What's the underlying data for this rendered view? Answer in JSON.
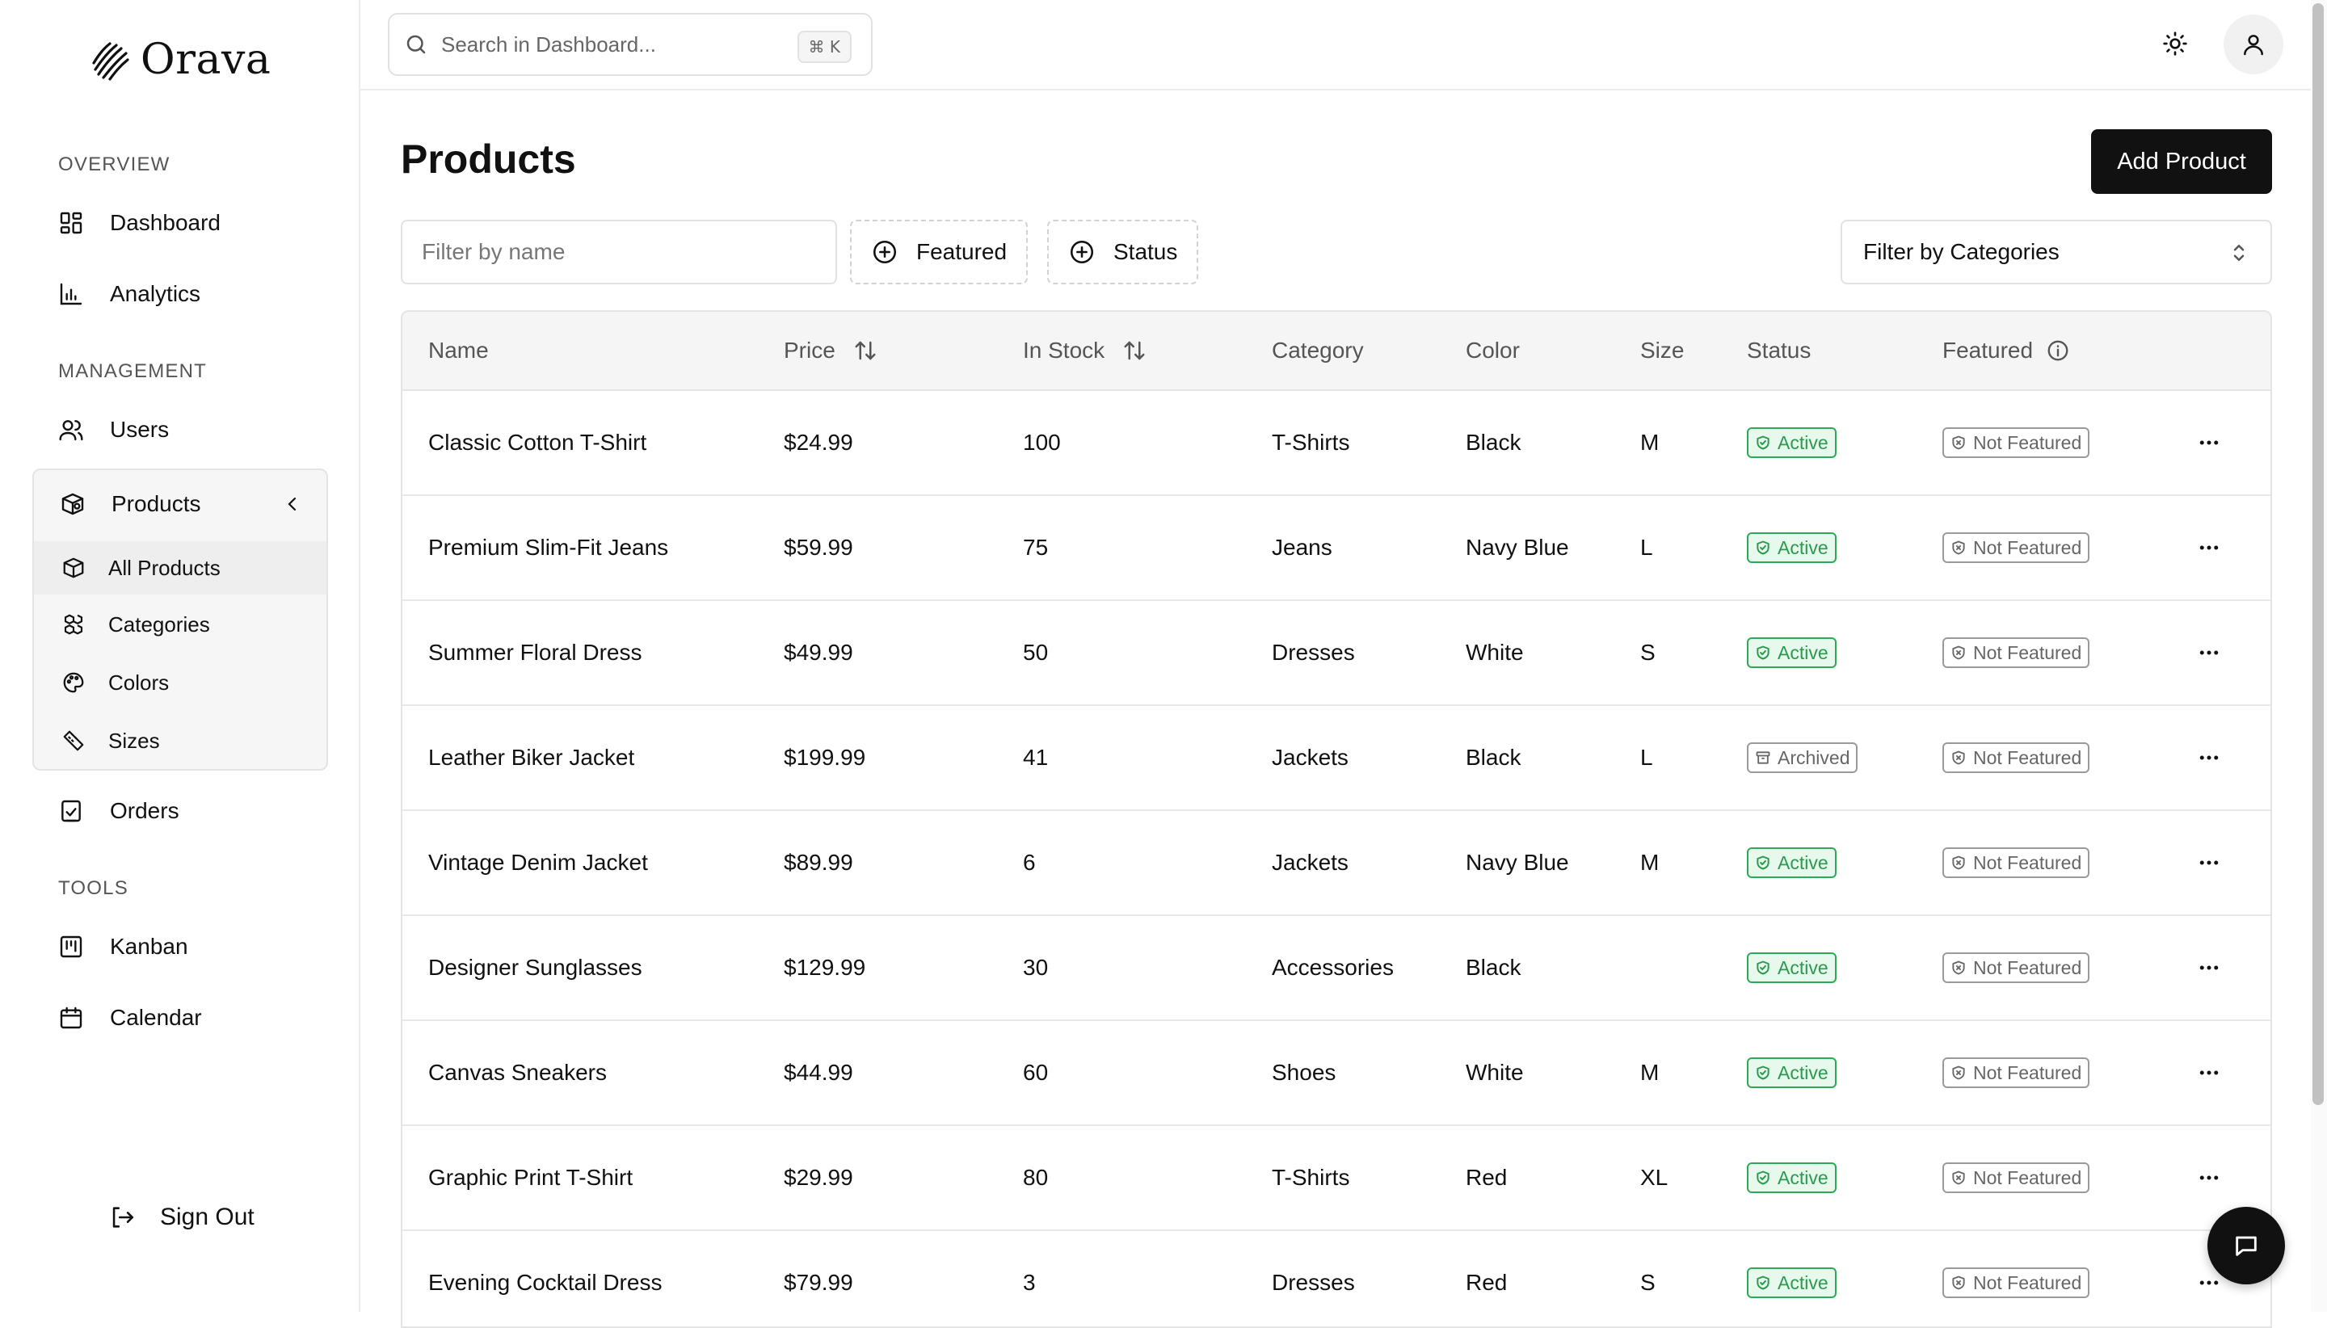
{
  "brand": {
    "name": "Orava"
  },
  "sidebar": {
    "sections": {
      "overview": "OVERVIEW",
      "management": "MANAGEMENT",
      "tools": "TOOLS"
    },
    "items": {
      "dashboard": {
        "label": "Dashboard",
        "icon": "dashboard-grid-icon"
      },
      "analytics": {
        "label": "Analytics",
        "icon": "bar-chart-icon"
      },
      "users": {
        "label": "Users",
        "icon": "users-icon"
      },
      "products": {
        "label": "Products",
        "icon": "products-icon"
      },
      "orders": {
        "label": "Orders",
        "icon": "clipboard-check-icon"
      },
      "kanban": {
        "label": "Kanban",
        "icon": "kanban-icon"
      },
      "calendar": {
        "label": "Calendar",
        "icon": "calendar-icon"
      }
    },
    "products_sub": {
      "all_products": "All Products",
      "categories": "Categories",
      "colors": "Colors",
      "sizes": "Sizes"
    },
    "sign_out": "Sign Out"
  },
  "topbar": {
    "search_placeholder": "Search in Dashboard...",
    "shortcut": "⌘ K"
  },
  "main": {
    "title": "Products",
    "add_button": "Add Product",
    "filter_placeholder": "Filter by name",
    "featured_filter": "Featured",
    "status_filter": "Status",
    "category_select": "Filter by Categories"
  },
  "table": {
    "columns": {
      "name": "Name",
      "price": "Price",
      "stock": "In Stock",
      "category": "Category",
      "color": "Color",
      "size": "Size",
      "status": "Status",
      "featured": "Featured"
    },
    "rows": [
      {
        "name": "Classic Cotton T-Shirt",
        "price": "$24.99",
        "stock": "100",
        "category": "T-Shirts",
        "color": "Black",
        "size": "M",
        "status": "Active",
        "featured": "Not Featured"
      },
      {
        "name": "Premium Slim-Fit Jeans",
        "price": "$59.99",
        "stock": "75",
        "category": "Jeans",
        "color": "Navy Blue",
        "size": "L",
        "status": "Active",
        "featured": "Not Featured"
      },
      {
        "name": "Summer Floral Dress",
        "price": "$49.99",
        "stock": "50",
        "category": "Dresses",
        "color": "White",
        "size": "S",
        "status": "Active",
        "featured": "Not Featured"
      },
      {
        "name": "Leather Biker Jacket",
        "price": "$199.99",
        "stock": "41",
        "category": "Jackets",
        "color": "Black",
        "size": "L",
        "status": "Archived",
        "featured": "Not Featured"
      },
      {
        "name": "Vintage Denim Jacket",
        "price": "$89.99",
        "stock": "6",
        "category": "Jackets",
        "color": "Navy Blue",
        "size": "M",
        "status": "Active",
        "featured": "Not Featured"
      },
      {
        "name": "Designer Sunglasses",
        "price": "$129.99",
        "stock": "30",
        "category": "Accessories",
        "color": "Black",
        "size": "",
        "status": "Active",
        "featured": "Not Featured"
      },
      {
        "name": "Canvas Sneakers",
        "price": "$44.99",
        "stock": "60",
        "category": "Shoes",
        "color": "White",
        "size": "M",
        "status": "Active",
        "featured": "Not Featured"
      },
      {
        "name": "Graphic Print T-Shirt",
        "price": "$29.99",
        "stock": "80",
        "category": "T-Shirts",
        "color": "Red",
        "size": "XL",
        "status": "Active",
        "featured": "Not Featured"
      },
      {
        "name": "Evening Cocktail Dress",
        "price": "$79.99",
        "stock": "3",
        "category": "Dresses",
        "color": "Red",
        "size": "S",
        "status": "Active",
        "featured": "Not Featured"
      }
    ]
  },
  "colors": {
    "accent": "#111111",
    "active_green": "#2a9a4e",
    "active_bg": "#e7f8ec",
    "muted": "#666666"
  }
}
